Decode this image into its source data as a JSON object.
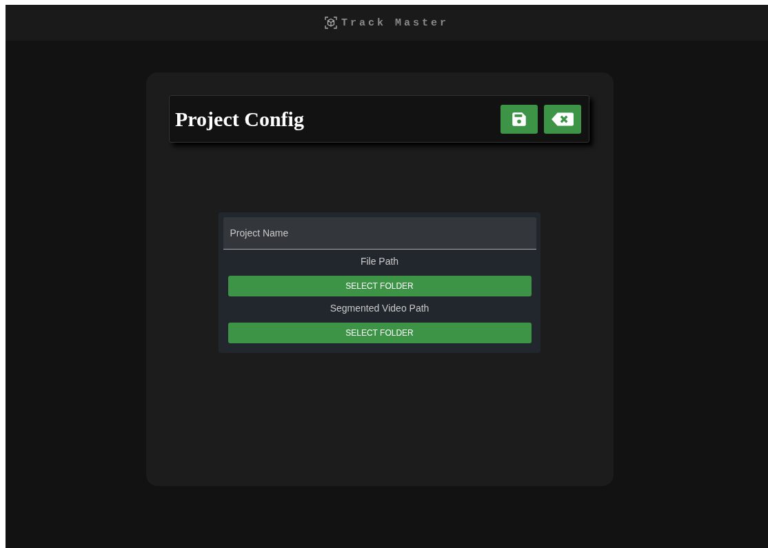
{
  "app_bar": {
    "title": "Track Master"
  },
  "panel": {
    "title": "Project Config"
  },
  "form": {
    "project_name": {
      "placeholder": "Project Name"
    },
    "paths": [
      {
        "label": "File Path",
        "button": "SELECT FOLDER"
      },
      {
        "label": "Segmented Video Path",
        "button": "SELECT FOLDER"
      }
    ]
  }
}
